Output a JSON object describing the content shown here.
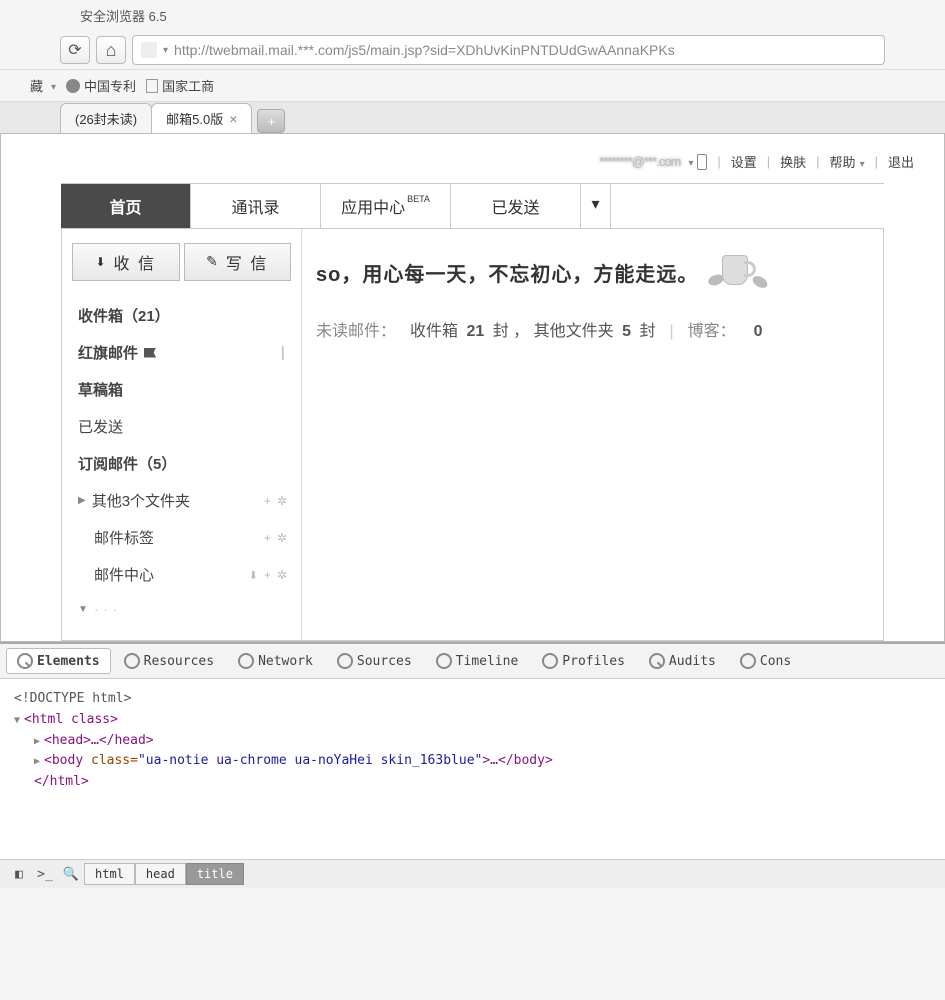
{
  "browser": {
    "title": "安全浏览器 6.5",
    "url": "http://twebmail.mail.***.com/js5/main.jsp?sid=XDhUvKinPNTDUdGwAAnnaKPKs"
  },
  "bookmarks": {
    "favorites_label": "藏",
    "items": [
      "中国专利",
      "国家工商"
    ]
  },
  "tabs": {
    "items": [
      {
        "label": "(26封未读)"
      },
      {
        "label": "邮箱5.0版"
      }
    ]
  },
  "mail": {
    "account_masked": "********@***.com",
    "header_links": {
      "settings": "设置",
      "skin": "换肤",
      "help": "帮助",
      "logout": "退出"
    },
    "nav": {
      "home": "首页",
      "contacts": "通讯录",
      "apps": "应用中心",
      "apps_badge": "BETA",
      "sent": "已发送"
    },
    "actions": {
      "receive": "收 信",
      "compose": "写 信"
    },
    "folders": {
      "inbox": "收件箱（21）",
      "redflag": "红旗邮件",
      "drafts": "草稿箱",
      "sent": "已发送",
      "subscribe": "订阅邮件（5）",
      "other3": "其他3个文件夹",
      "labels": "邮件标签",
      "center": "邮件中心"
    },
    "content": {
      "motto": "so，用心每一天，不忘初心，方能走远。",
      "unread_label": "未读邮件：",
      "inbox_summary_pre": "收件箱",
      "inbox_count": "21",
      "inbox_summary_suf": "封 ，",
      "other_pre": "其他文件夹",
      "other_count": "5",
      "other_suf": "封",
      "blog_label": "博客：",
      "blog_count": "0"
    }
  },
  "devtools": {
    "tabs": [
      "Elements",
      "Resources",
      "Network",
      "Sources",
      "Timeline",
      "Profiles",
      "Audits",
      "Cons"
    ],
    "dom": {
      "doctype": "<!DOCTYPE html>",
      "html_open": "<html class>",
      "head": "<head>…</head>",
      "body_open": "<body ",
      "body_attr": "class=",
      "body_val": "\"ua-notie ua-chrome ua-noYaHei skin_163blue\"",
      "body_close": ">…</body>",
      "html_close": "</html>"
    },
    "crumbs": [
      "html",
      "head",
      "title"
    ]
  }
}
